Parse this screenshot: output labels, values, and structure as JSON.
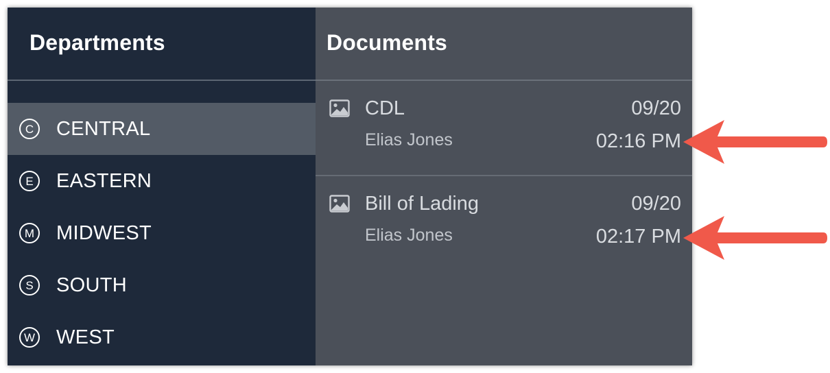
{
  "departments": {
    "title": "Departments",
    "items": [
      {
        "badge": "C",
        "label": "CENTRAL",
        "selected": true
      },
      {
        "badge": "E",
        "label": "EASTERN",
        "selected": false
      },
      {
        "badge": "M",
        "label": "MIDWEST",
        "selected": false
      },
      {
        "badge": "S",
        "label": "SOUTH",
        "selected": false
      },
      {
        "badge": "W",
        "label": "WEST",
        "selected": false
      }
    ]
  },
  "documents": {
    "title": "Documents",
    "items": [
      {
        "icon": "image-icon",
        "title": "CDL",
        "author": "Elias Jones",
        "date": "09/20",
        "time": "02:16 PM"
      },
      {
        "icon": "image-icon",
        "title": "Bill of Lading",
        "author": "Elias Jones",
        "date": "09/20",
        "time": "02:17 PM"
      }
    ]
  },
  "annotations": {
    "arrow_color": "#f0594a"
  },
  "colors": {
    "departments_bg": "#1e293a",
    "departments_selected": "#535b66",
    "documents_bg": "#4b5059"
  }
}
